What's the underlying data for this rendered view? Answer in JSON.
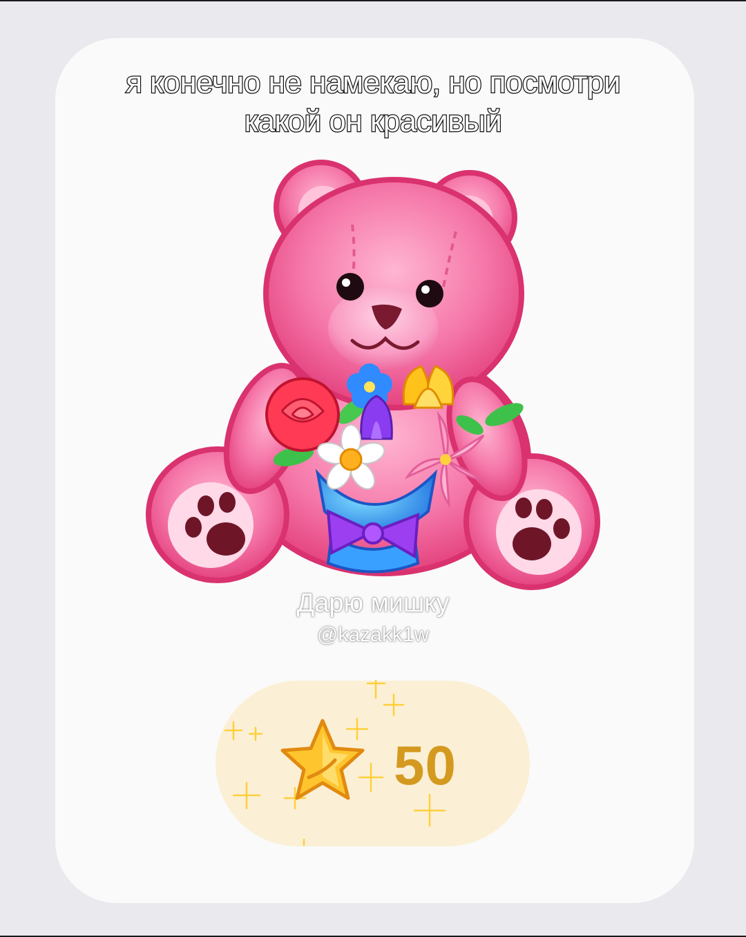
{
  "caption": {
    "line1": "я конечно не намекаю, но посмотри",
    "line2": "какой он красивый"
  },
  "gift": {
    "title": "Дарю мишку",
    "username": "@kazakk1w",
    "price": "50",
    "image_icon": "pink-teddy-bear-with-bouquet",
    "currency_icon": "star-icon"
  },
  "colors": {
    "page_background": "#e9e9ee",
    "card_background": "#fafafa",
    "price_pill": "#fbf0d6",
    "price_text": "#d49a20",
    "bear_pink": "#f0689f"
  }
}
